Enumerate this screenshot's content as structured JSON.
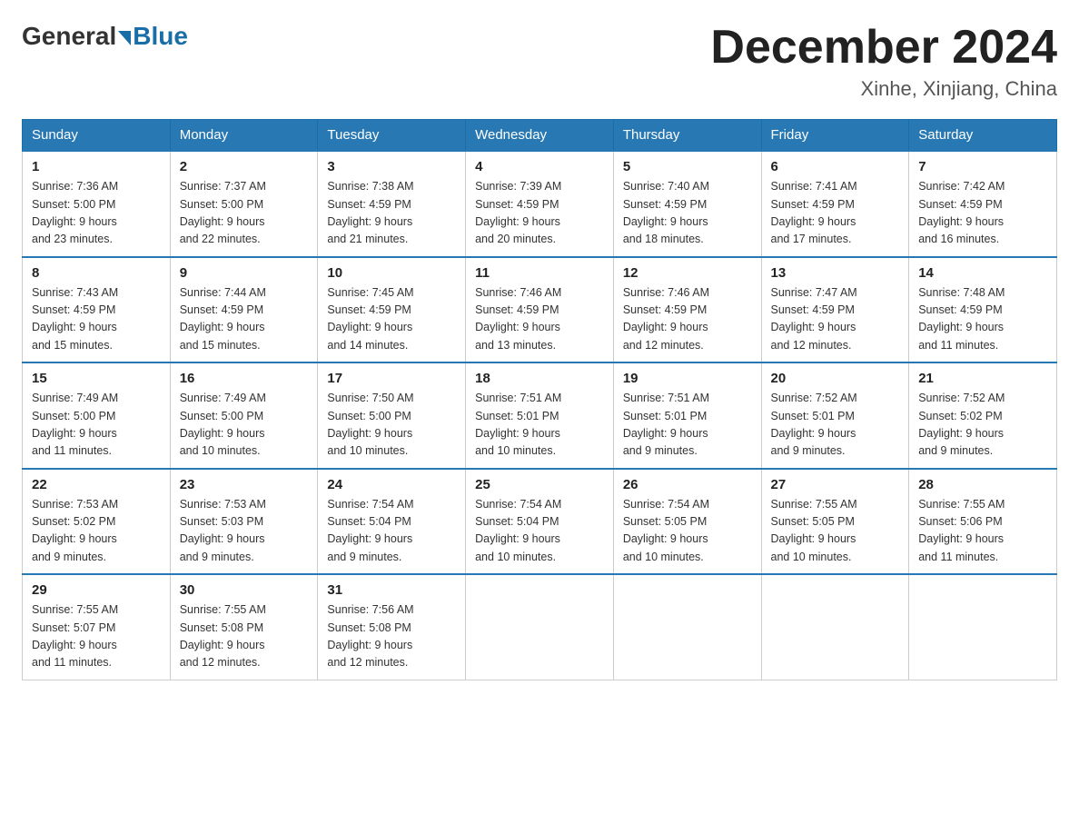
{
  "header": {
    "logo_general": "General",
    "logo_blue": "Blue",
    "month_title": "December 2024",
    "location": "Xinhe, Xinjiang, China"
  },
  "days_of_week": [
    "Sunday",
    "Monday",
    "Tuesday",
    "Wednesday",
    "Thursday",
    "Friday",
    "Saturday"
  ],
  "weeks": [
    [
      {
        "day": "1",
        "sunrise": "7:36 AM",
        "sunset": "5:00 PM",
        "daylight": "9 hours and 23 minutes."
      },
      {
        "day": "2",
        "sunrise": "7:37 AM",
        "sunset": "5:00 PM",
        "daylight": "9 hours and 22 minutes."
      },
      {
        "day": "3",
        "sunrise": "7:38 AM",
        "sunset": "4:59 PM",
        "daylight": "9 hours and 21 minutes."
      },
      {
        "day": "4",
        "sunrise": "7:39 AM",
        "sunset": "4:59 PM",
        "daylight": "9 hours and 20 minutes."
      },
      {
        "day": "5",
        "sunrise": "7:40 AM",
        "sunset": "4:59 PM",
        "daylight": "9 hours and 18 minutes."
      },
      {
        "day": "6",
        "sunrise": "7:41 AM",
        "sunset": "4:59 PM",
        "daylight": "9 hours and 17 minutes."
      },
      {
        "day": "7",
        "sunrise": "7:42 AM",
        "sunset": "4:59 PM",
        "daylight": "9 hours and 16 minutes."
      }
    ],
    [
      {
        "day": "8",
        "sunrise": "7:43 AM",
        "sunset": "4:59 PM",
        "daylight": "9 hours and 15 minutes."
      },
      {
        "day": "9",
        "sunrise": "7:44 AM",
        "sunset": "4:59 PM",
        "daylight": "9 hours and 15 minutes."
      },
      {
        "day": "10",
        "sunrise": "7:45 AM",
        "sunset": "4:59 PM",
        "daylight": "9 hours and 14 minutes."
      },
      {
        "day": "11",
        "sunrise": "7:46 AM",
        "sunset": "4:59 PM",
        "daylight": "9 hours and 13 minutes."
      },
      {
        "day": "12",
        "sunrise": "7:46 AM",
        "sunset": "4:59 PM",
        "daylight": "9 hours and 12 minutes."
      },
      {
        "day": "13",
        "sunrise": "7:47 AM",
        "sunset": "4:59 PM",
        "daylight": "9 hours and 12 minutes."
      },
      {
        "day": "14",
        "sunrise": "7:48 AM",
        "sunset": "4:59 PM",
        "daylight": "9 hours and 11 minutes."
      }
    ],
    [
      {
        "day": "15",
        "sunrise": "7:49 AM",
        "sunset": "5:00 PM",
        "daylight": "9 hours and 11 minutes."
      },
      {
        "day": "16",
        "sunrise": "7:49 AM",
        "sunset": "5:00 PM",
        "daylight": "9 hours and 10 minutes."
      },
      {
        "day": "17",
        "sunrise": "7:50 AM",
        "sunset": "5:00 PM",
        "daylight": "9 hours and 10 minutes."
      },
      {
        "day": "18",
        "sunrise": "7:51 AM",
        "sunset": "5:01 PM",
        "daylight": "9 hours and 10 minutes."
      },
      {
        "day": "19",
        "sunrise": "7:51 AM",
        "sunset": "5:01 PM",
        "daylight": "9 hours and 9 minutes."
      },
      {
        "day": "20",
        "sunrise": "7:52 AM",
        "sunset": "5:01 PM",
        "daylight": "9 hours and 9 minutes."
      },
      {
        "day": "21",
        "sunrise": "7:52 AM",
        "sunset": "5:02 PM",
        "daylight": "9 hours and 9 minutes."
      }
    ],
    [
      {
        "day": "22",
        "sunrise": "7:53 AM",
        "sunset": "5:02 PM",
        "daylight": "9 hours and 9 minutes."
      },
      {
        "day": "23",
        "sunrise": "7:53 AM",
        "sunset": "5:03 PM",
        "daylight": "9 hours and 9 minutes."
      },
      {
        "day": "24",
        "sunrise": "7:54 AM",
        "sunset": "5:04 PM",
        "daylight": "9 hours and 9 minutes."
      },
      {
        "day": "25",
        "sunrise": "7:54 AM",
        "sunset": "5:04 PM",
        "daylight": "9 hours and 10 minutes."
      },
      {
        "day": "26",
        "sunrise": "7:54 AM",
        "sunset": "5:05 PM",
        "daylight": "9 hours and 10 minutes."
      },
      {
        "day": "27",
        "sunrise": "7:55 AM",
        "sunset": "5:05 PM",
        "daylight": "9 hours and 10 minutes."
      },
      {
        "day": "28",
        "sunrise": "7:55 AM",
        "sunset": "5:06 PM",
        "daylight": "9 hours and 11 minutes."
      }
    ],
    [
      {
        "day": "29",
        "sunrise": "7:55 AM",
        "sunset": "5:07 PM",
        "daylight": "9 hours and 11 minutes."
      },
      {
        "day": "30",
        "sunrise": "7:55 AM",
        "sunset": "5:08 PM",
        "daylight": "9 hours and 12 minutes."
      },
      {
        "day": "31",
        "sunrise": "7:56 AM",
        "sunset": "5:08 PM",
        "daylight": "9 hours and 12 minutes."
      },
      null,
      null,
      null,
      null
    ]
  ],
  "labels": {
    "sunrise": "Sunrise:",
    "sunset": "Sunset:",
    "daylight": "Daylight:"
  }
}
